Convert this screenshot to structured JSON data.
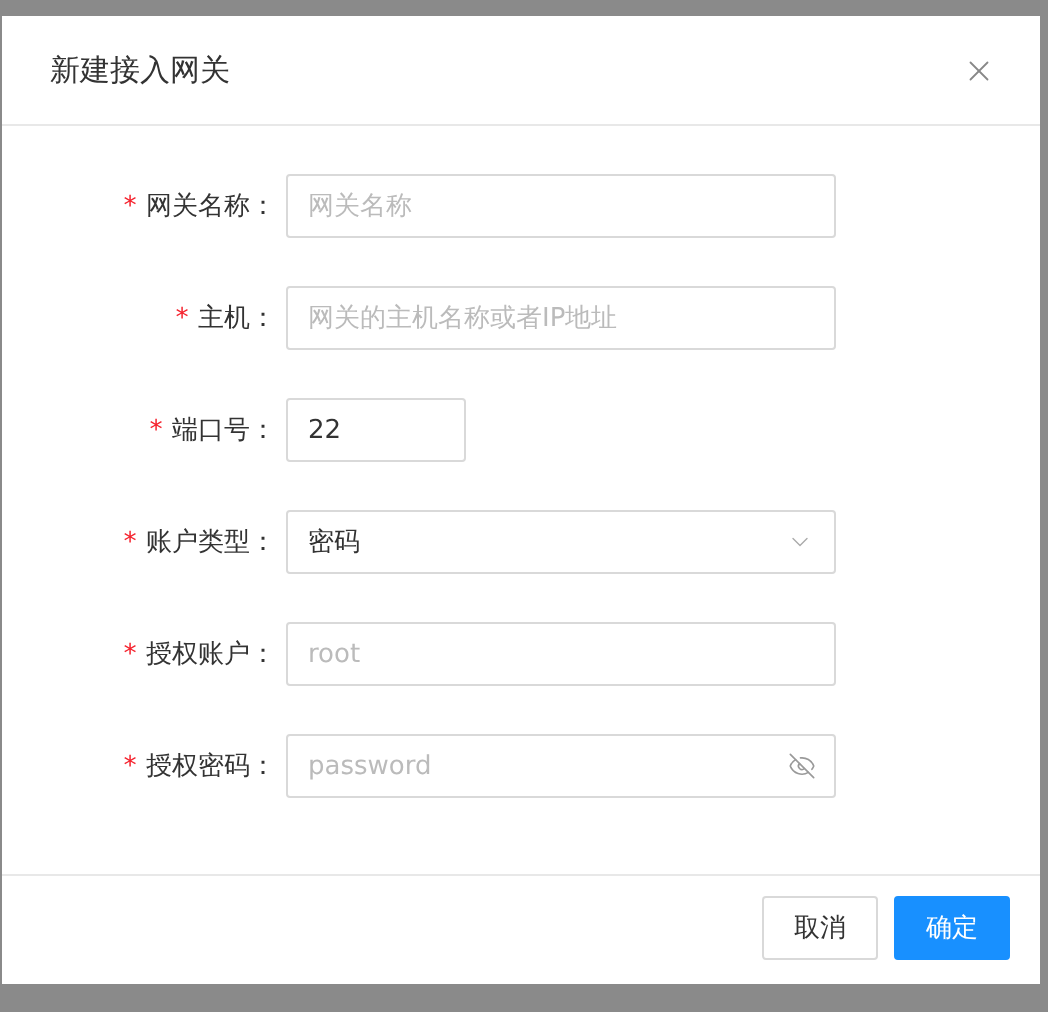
{
  "dialog": {
    "title": "新建接入网关"
  },
  "fields": [
    {
      "kind": "text",
      "required_mark": "*",
      "label": "网关名称：",
      "placeholder": "网关名称",
      "wide": true
    },
    {
      "kind": "text",
      "required_mark": "*",
      "label": "主机：",
      "placeholder": "网关的主机名称或者IP地址",
      "wide": true
    },
    {
      "kind": "text",
      "required_mark": "*",
      "label": "端口号：",
      "value": "22",
      "wide": false
    },
    {
      "kind": "select",
      "required_mark": "*",
      "label": "账户类型：",
      "value": "密码",
      "wide": true
    },
    {
      "kind": "text",
      "required_mark": "*",
      "label": "授权账户：",
      "placeholder": "root",
      "wide": true
    },
    {
      "kind": "password",
      "required_mark": "*",
      "label": "授权密码：",
      "placeholder": "password",
      "wide": true
    }
  ],
  "buttons": [
    {
      "label": "取消",
      "primary": false
    },
    {
      "label": "确定",
      "primary": true
    }
  ]
}
